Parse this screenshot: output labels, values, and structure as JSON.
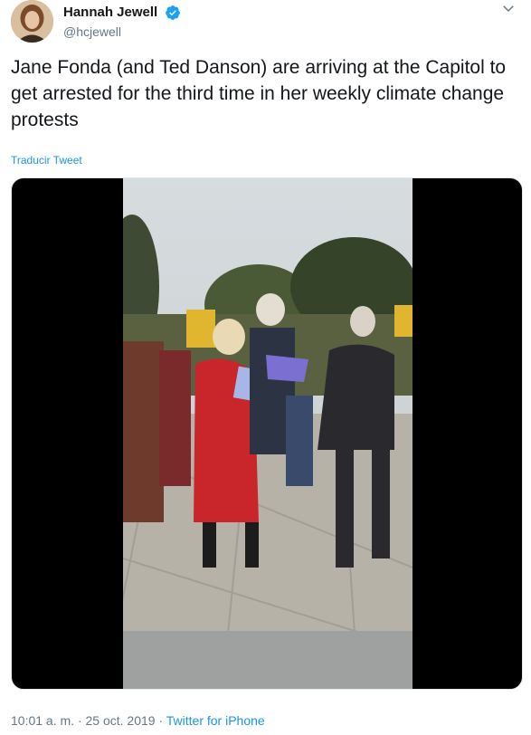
{
  "author": {
    "display_name": "Hannah Jewell",
    "handle": "@hcjewell",
    "verified_icon": "verified-badge-icon",
    "accent_color": "#1da1f2"
  },
  "tweet": {
    "text": "Jane Fonda (and Ted Danson) are arriving at the Capitol to get arrested for the third time in her weekly climate change protests",
    "translate_label": "Traducir Tweet"
  },
  "media": {
    "type": "video"
  },
  "footer": {
    "time": "10:01 a. m.",
    "separator1": "·",
    "date": "25 oct. 2019",
    "separator2": "·",
    "source": "Twitter for iPhone"
  },
  "colors": {
    "text": "#14171a",
    "muted": "#657786",
    "link": "#1b95e0"
  }
}
